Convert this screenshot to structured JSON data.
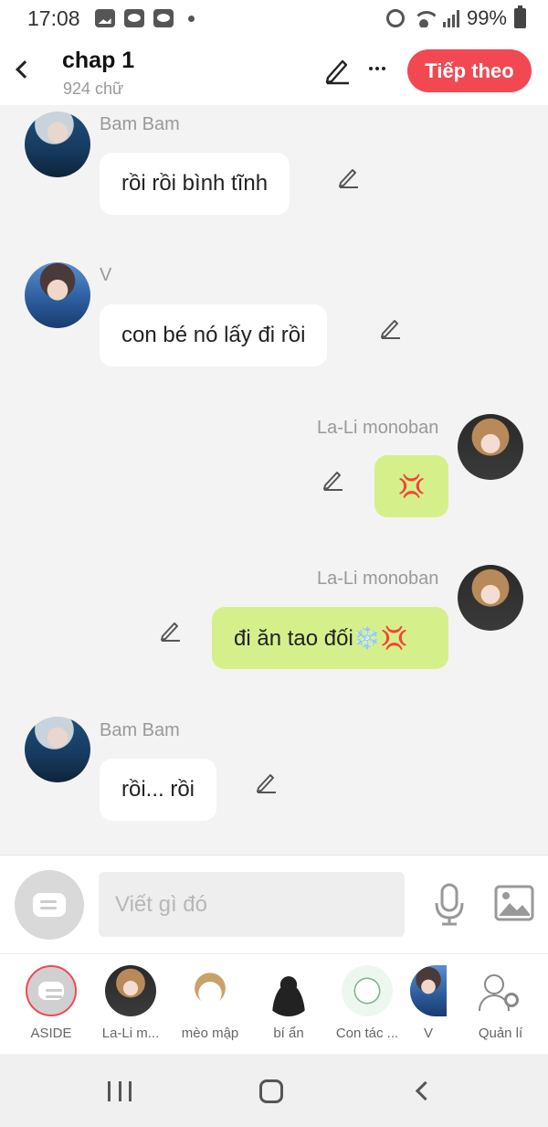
{
  "status_bar": {
    "time": "17:08",
    "battery": "99%"
  },
  "header": {
    "title": "chap 1",
    "subtitle": "924 chữ",
    "next_label": "Tiếp theo"
  },
  "messages": [
    {
      "sender": "Bam Bam",
      "text": "rồi rồi bình tĩnh",
      "side": "left",
      "avatar": "bambam"
    },
    {
      "sender": "V",
      "text": "con bé nó lấy đi rồi",
      "side": "left",
      "avatar": "v"
    },
    {
      "sender": "La-Li monoban",
      "text": "💢",
      "side": "right",
      "avatar": "lali"
    },
    {
      "sender": "La-Li monoban",
      "text": "đi ăn tao đối❄️💢",
      "side": "right",
      "avatar": "lali"
    },
    {
      "sender": "Bam Bam",
      "text": "rồi... rồi",
      "side": "left",
      "avatar": "bambam"
    }
  ],
  "composer": {
    "placeholder": "Viết gì đó"
  },
  "characters": [
    {
      "label": "ASIDE"
    },
    {
      "label": "La-Li m..."
    },
    {
      "label": "mèo mập"
    },
    {
      "label": "bí ẩn"
    },
    {
      "label": "Con tác ..."
    },
    {
      "label": "V"
    },
    {
      "label": "Quản lí"
    }
  ],
  "colors": {
    "accent": "#f14852",
    "my_bubble": "#d5f08a",
    "other_bubble": "#ffffff",
    "chat_bg": "#f3f3f3"
  }
}
